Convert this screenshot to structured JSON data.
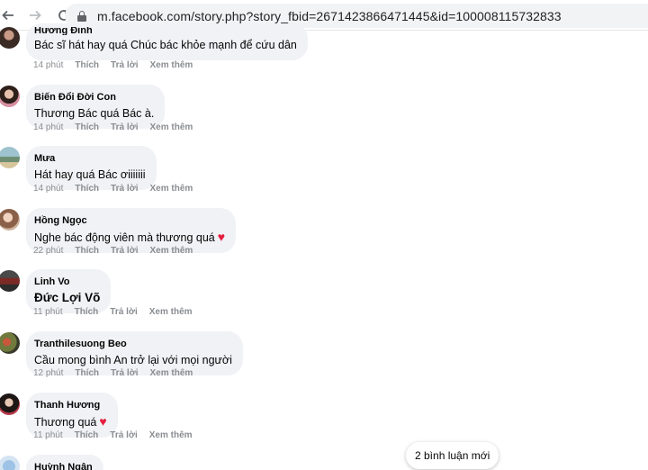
{
  "browser": {
    "url": "m.facebook.com/story.php?story_fbid=2671423866471445&id=100008115732833"
  },
  "actions": {
    "like": "Thích",
    "reply": "Trả lời",
    "more": "Xem thêm"
  },
  "comments": [
    {
      "author": "Hương Đinh",
      "text": "Bác sĩ hát hay quá Chúc bác khỏe mạnh để cứu dân",
      "time": "14 phút"
    },
    {
      "author": "Biến Đổi Đời Con",
      "text": "Thương Bác quá Bác à.",
      "time": "14 phút"
    },
    {
      "author": "Mưa",
      "text": "Hát hay quá Bác ơiiiiiii",
      "time": "14 phút"
    },
    {
      "author": "Hồng Ngọc",
      "text": "Nghe bác động viên mà thương quá",
      "time": "22 phút",
      "emoji": "♥"
    },
    {
      "author": "Linh Vo",
      "text": "Đức Lợi Võ",
      "time": "11 phút"
    },
    {
      "author": "Tranthilesuong Beo",
      "text": "Cầu mong bình An trở lại với mọi người",
      "time": "12 phút"
    },
    {
      "author": "Thanh Hương",
      "text": "Thương quá",
      "time": "11 phút",
      "emoji": "♥"
    },
    {
      "author": "Huỳnh Ngân",
      "text": "",
      "time": ""
    }
  ],
  "new_comments_label": "2 bình luận mới",
  "colors": {
    "bubble": "#f0f2f5",
    "meta": "#8a8d91",
    "heart": "#e41e3f"
  }
}
